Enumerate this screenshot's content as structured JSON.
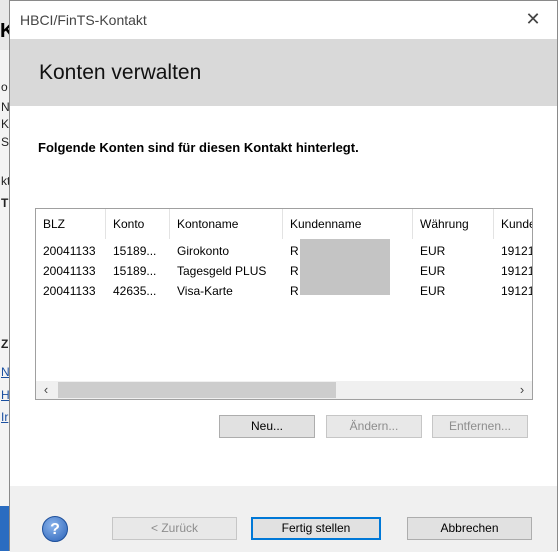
{
  "window": {
    "title": "HBCI/FinTS-Kontakt"
  },
  "header": {
    "title": "Konten verwalten"
  },
  "content": {
    "subtitle": "Folgende Konten sind für diesen Kontakt hinterlegt."
  },
  "table": {
    "columns": [
      "BLZ",
      "Konto",
      "Kontoname",
      "Kundenname",
      "Währung",
      "Kunde"
    ],
    "rows": [
      [
        "20041133",
        "15189...",
        "Girokonto",
        "R",
        "EUR",
        "19121"
      ],
      [
        "20041133",
        "15189...",
        "Tagesgeld PLUS",
        "R",
        "EUR",
        "19121"
      ],
      [
        "20041133",
        "42635...",
        "Visa-Karte",
        "R",
        "EUR",
        "19121"
      ]
    ]
  },
  "list_buttons": {
    "new": "Neu...",
    "edit": "Ändern...",
    "remove": "Entfernen..."
  },
  "footer": {
    "back": "< Zurück",
    "finish": "Fertig stellen",
    "cancel": "Abbrechen",
    "help": "?"
  },
  "background": {
    "letter": "K",
    "fragments": [
      "o",
      "N",
      "K",
      "S",
      "kt",
      "T",
      "Z",
      "N",
      "H",
      "Ir"
    ]
  }
}
